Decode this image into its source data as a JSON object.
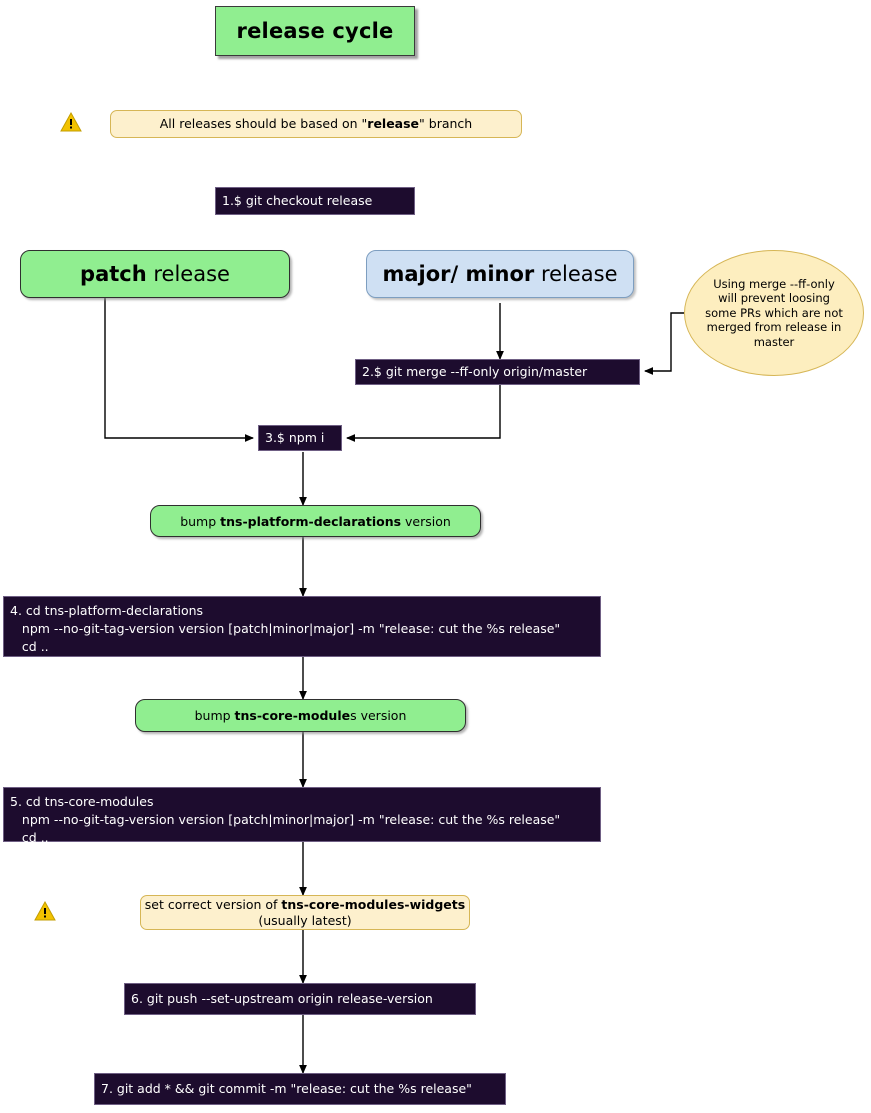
{
  "diagram": {
    "title": "release cycle",
    "warning_icon_name": "warning-triangle-icon",
    "notes": {
      "release_branch": {
        "text_before": "All releases should be based on \"",
        "bold": "release",
        "text_after": "\" branch"
      },
      "widgets_version": {
        "line1_before": "set correct version of ",
        "line1_bold": "tns-core-modules-widgets",
        "line2": "(usually latest)"
      },
      "ff_only_ellipse": "Using merge --ff-only will prevent loosing some PRs which are not merged from release in master"
    },
    "branches": {
      "patch": {
        "bold": "patch",
        "rest": " release"
      },
      "major_minor": {
        "bold": "major/ minor",
        "rest": " release"
      }
    },
    "steps": {
      "step1": "1.$ git checkout release",
      "step2": "2.$ git merge --ff-only origin/master",
      "step3": "3.$ npm i",
      "step4": "4. cd tns-platform-declarations\n   npm --no-git-tag-version version [patch|minor|major] -m \"release: cut the %s release\"\n   cd ..",
      "step5": "5. cd tns-core-modules\n   npm --no-git-tag-version version [patch|minor|major] -m \"release: cut the %s release\"\n   cd ..",
      "step6": "6. git push --set-upstream origin release-version",
      "step7": "7. git add * && git commit -m \"release: cut the %s release\""
    },
    "bumps": {
      "declarations": {
        "before": "bump ",
        "bold": "tns-platform-declarations",
        "after": " version"
      },
      "core_modules": {
        "before": "bump ",
        "bold": "tns-core-module",
        "after": "s version"
      }
    },
    "colors": {
      "green": "#90ee90",
      "blue": "#cfe0f3",
      "dark": "#1d0c2e",
      "note_bg": "#fdf0cd",
      "note_border": "#d6b656",
      "warning": "#f2c200"
    }
  }
}
